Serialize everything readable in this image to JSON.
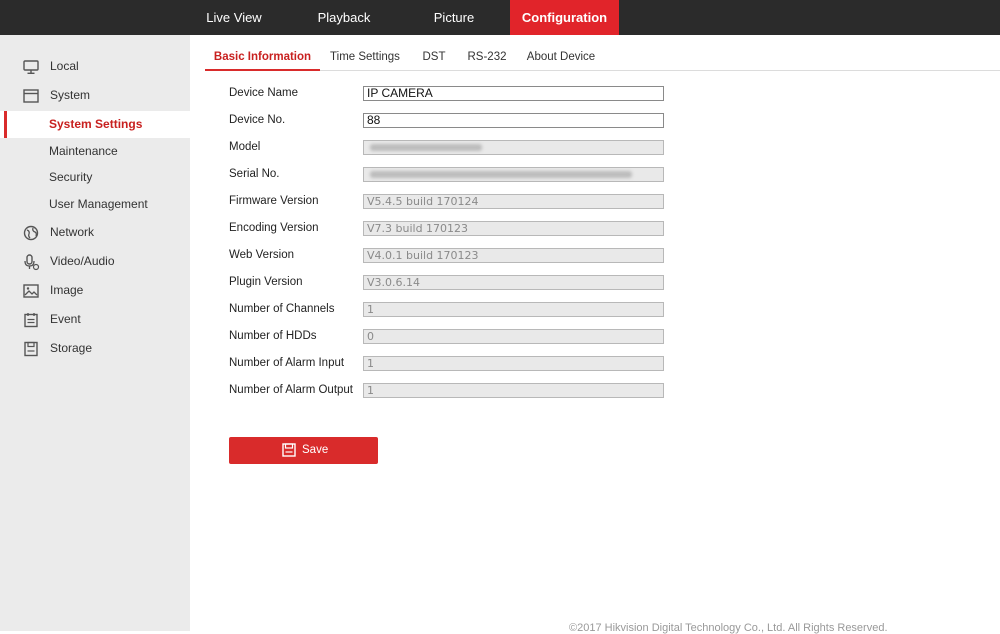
{
  "top_nav": {
    "items": [
      {
        "label": "Live View"
      },
      {
        "label": "Playback"
      },
      {
        "label": "Picture"
      },
      {
        "label": "Configuration"
      }
    ]
  },
  "sidebar": {
    "items": [
      {
        "label": "Local",
        "icon": "monitor-icon"
      },
      {
        "label": "System",
        "icon": "window-icon"
      },
      {
        "label": "System Settings"
      },
      {
        "label": "Maintenance"
      },
      {
        "label": "Security"
      },
      {
        "label": "User Management"
      },
      {
        "label": "Network",
        "icon": "globe-icon"
      },
      {
        "label": "Video/Audio",
        "icon": "microphone-icon"
      },
      {
        "label": "Image",
        "icon": "image-icon"
      },
      {
        "label": "Event",
        "icon": "calendar-icon"
      },
      {
        "label": "Storage",
        "icon": "disk-icon"
      }
    ],
    "active": "System Settings"
  },
  "tabs": {
    "items": [
      {
        "label": "Basic Information"
      },
      {
        "label": "Time Settings"
      },
      {
        "label": "DST"
      },
      {
        "label": "RS-232"
      },
      {
        "label": "About Device"
      }
    ],
    "active": "Basic Information"
  },
  "form": {
    "device_name": {
      "label": "Device Name",
      "value": "IP CAMERA"
    },
    "device_no": {
      "label": "Device No.",
      "value": "88"
    },
    "model": {
      "label": "Model"
    },
    "serial_no": {
      "label": "Serial No."
    },
    "firmware_version": {
      "label": "Firmware Version",
      "value": "V5.4.5 build 170124"
    },
    "encoding_version": {
      "label": "Encoding Version",
      "value": "V7.3 build 170123"
    },
    "web_version": {
      "label": "Web Version",
      "value": "V4.0.1 build 170123"
    },
    "plugin_version": {
      "label": "Plugin Version",
      "value": "V3.0.6.14"
    },
    "num_channels": {
      "label": "Number of Channels",
      "value": "1"
    },
    "num_hdds": {
      "label": "Number of HDDs",
      "value": "0"
    },
    "num_alarm_input": {
      "label": "Number of Alarm Input",
      "value": "1"
    },
    "num_alarm_output": {
      "label": "Number of Alarm Output",
      "value": "1"
    }
  },
  "actions": {
    "save_label": "Save"
  },
  "footer": {
    "copyright": "©2017 Hikvision Digital Technology Co., Ltd. All Rights Reserved."
  },
  "colors": {
    "accent": "#d92b2b",
    "topbar": "#2b2b2b",
    "sidebar": "#ebebeb"
  }
}
